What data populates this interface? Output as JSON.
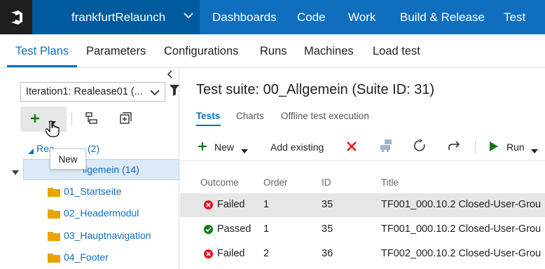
{
  "header": {
    "project": "frankfurtRelaunch",
    "hubs": [
      "Dashboards",
      "Code",
      "Work",
      "Build & Release",
      "Test"
    ]
  },
  "subnav": {
    "tabs": [
      "Test Plans",
      "Parameters",
      "Configurations",
      "Runs",
      "Machines",
      "Load test"
    ],
    "active": "Test Plans"
  },
  "left": {
    "iteration": "Iteration1: Realease01 (...",
    "tooltip": "New",
    "tree": {
      "root": "Realease01 (2)",
      "root_prefix": "Rea",
      "root_suffix": "(2)",
      "selected": "00_Allgemein (14)",
      "selected_visible": "llgemein (14)",
      "children": [
        "01_Startseite",
        "02_Headermodul",
        "03_Hauptnavigation",
        "04_Footer"
      ]
    }
  },
  "main": {
    "suite_title": "Test suite: 00_Allgemein (Suite ID: 31)",
    "tabs": [
      "Tests",
      "Charts",
      "Offline test execution"
    ],
    "toolbar": {
      "new_label": "New",
      "add_existing_label": "Add existing",
      "run_label": "Run"
    },
    "columns": [
      "Outcome",
      "Order",
      "ID",
      "Title"
    ],
    "rows": [
      {
        "outcome": "Failed",
        "order": "1",
        "id": "35",
        "title": "TF001_000.10.2 Closed-User-Grou"
      },
      {
        "outcome": "Passed",
        "order": "1",
        "id": "35",
        "title": "TF001_000.10.2 Closed-User-Grou"
      },
      {
        "outcome": "Failed",
        "order": "2",
        "id": "36",
        "title": "TF002_000.10.2 Closed-User-Grou"
      }
    ]
  },
  "colors": {
    "accent": "#106ebe",
    "project_bg": "#005a9e",
    "failed": "#e81123",
    "passed": "#107c10"
  }
}
